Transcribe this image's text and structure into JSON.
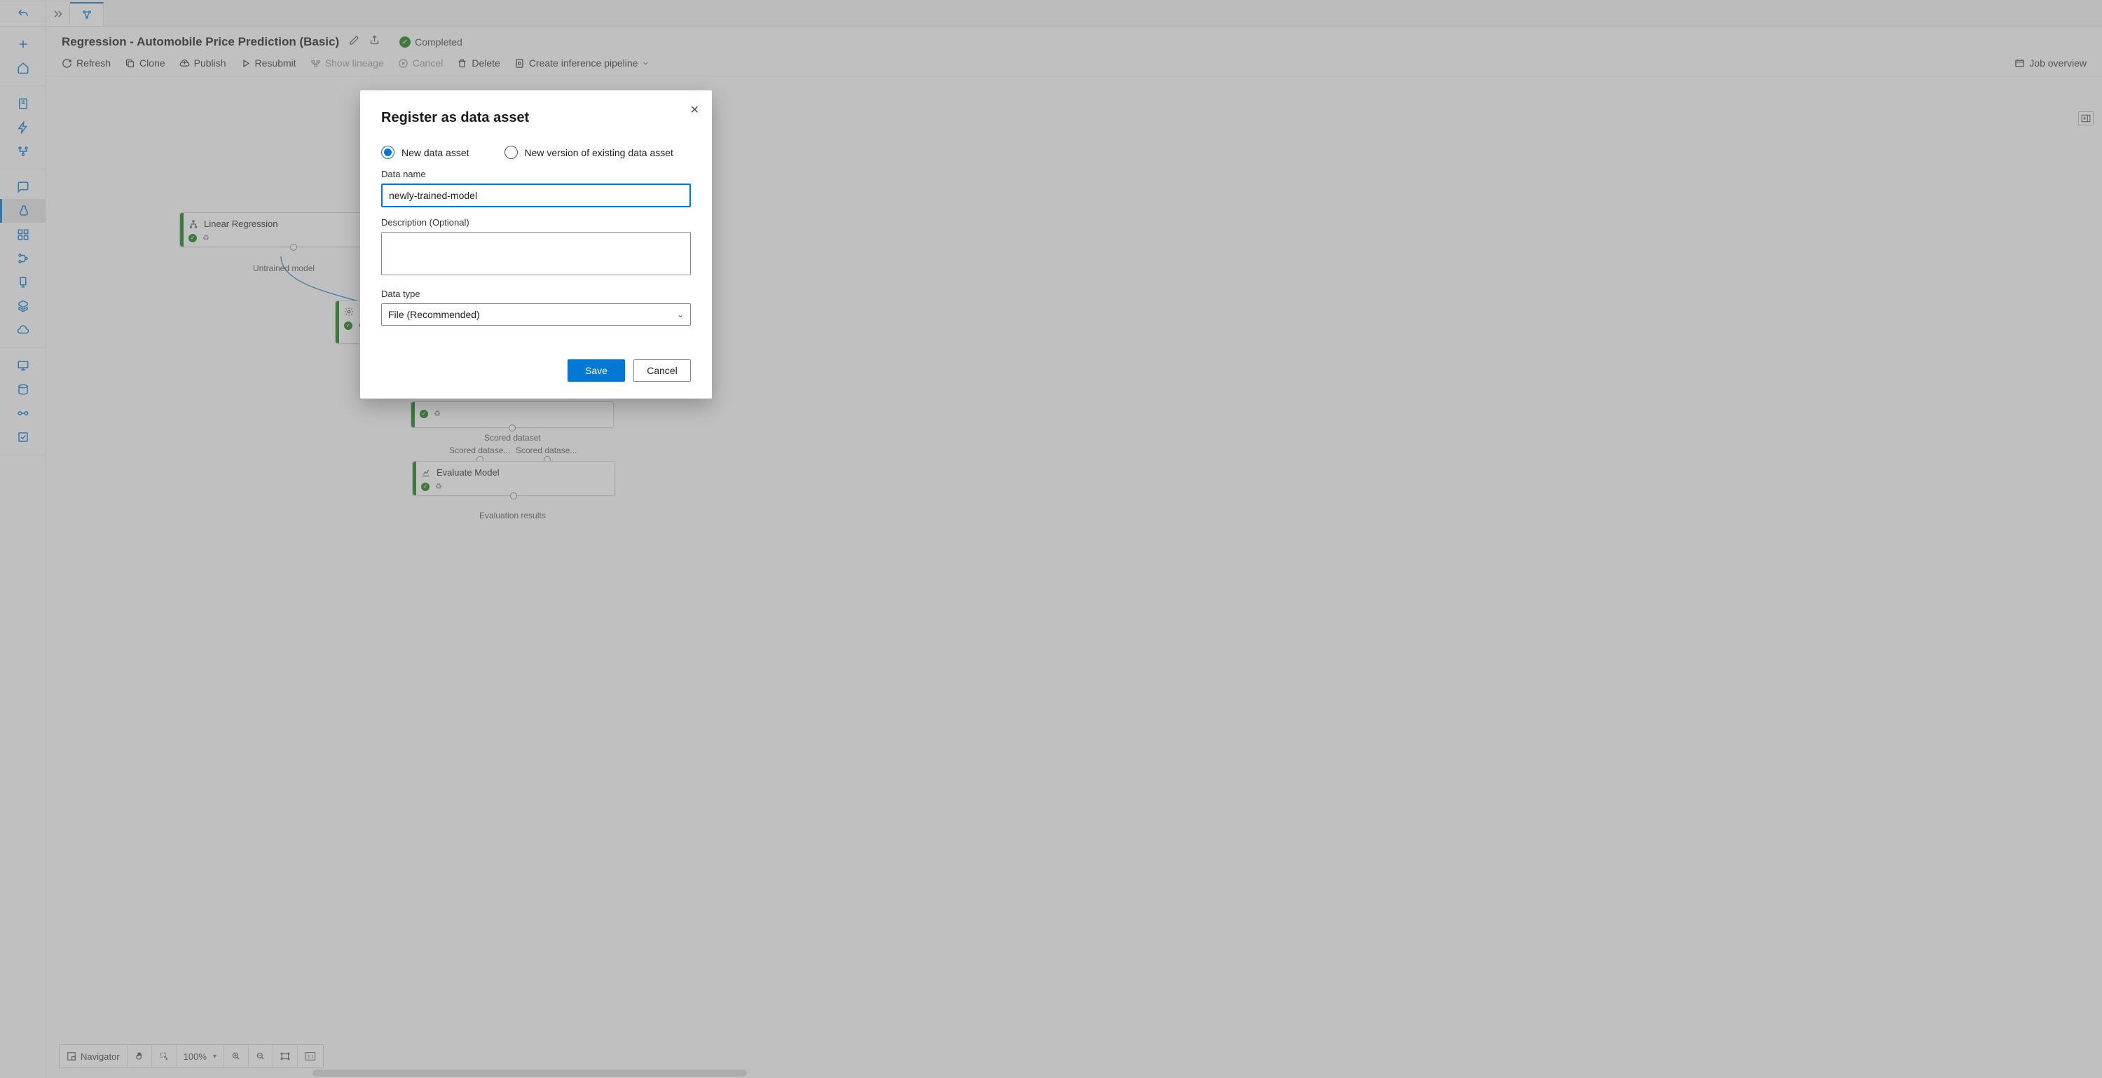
{
  "header": {
    "title": "Regression - Automobile Price Prediction (Basic)",
    "status": "Completed"
  },
  "toolbar": {
    "refresh": "Refresh",
    "clone": "Clone",
    "publish": "Publish",
    "resubmit": "Resubmit",
    "show_lineage": "Show lineage",
    "cancel": "Cancel",
    "delete": "Delete",
    "create_inference": "Create inference pipeline",
    "job_overview": "Job overview"
  },
  "canvas": {
    "nodes": {
      "linear_regression": "Linear Regression",
      "evaluate_model": "Evaluate Model"
    },
    "labels": {
      "untrained_model": "Untrained model",
      "scored_dataset": "Scored dataset",
      "scored_left": "Scored datase...",
      "scored_right": "Scored datase...",
      "evaluation_results": "Evaluation results"
    }
  },
  "navigator": {
    "label": "Navigator",
    "zoom": "100%"
  },
  "modal": {
    "title": "Register as data asset",
    "radio_new": "New data asset",
    "radio_existing": "New version of existing data asset",
    "data_name_label": "Data name",
    "data_name_value": "newly-trained-model",
    "description_label": "Description (Optional)",
    "description_value": "",
    "data_type_label": "Data type",
    "data_type_value": "File (Recommended)",
    "save": "Save",
    "cancel": "Cancel"
  }
}
